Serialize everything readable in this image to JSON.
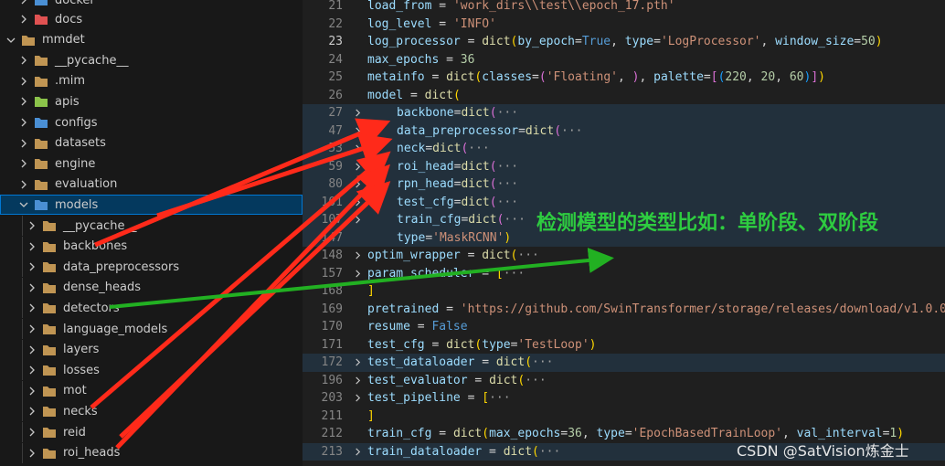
{
  "explorer": {
    "items": [
      {
        "label": "docker",
        "type": "folder-blue",
        "expanded": false,
        "depth": 1
      },
      {
        "label": "docs",
        "type": "folder-red",
        "expanded": false,
        "depth": 1
      },
      {
        "label": "mmdet",
        "type": "folder",
        "expanded": true,
        "depth": 0
      },
      {
        "label": "__pycache__",
        "type": "folder",
        "expanded": false,
        "depth": 1
      },
      {
        "label": ".mim",
        "type": "folder",
        "expanded": false,
        "depth": 1
      },
      {
        "label": "apis",
        "type": "folder-green",
        "expanded": false,
        "depth": 1
      },
      {
        "label": "configs",
        "type": "folder-blue",
        "expanded": false,
        "depth": 1
      },
      {
        "label": "datasets",
        "type": "folder",
        "expanded": false,
        "depth": 1
      },
      {
        "label": "engine",
        "type": "folder",
        "expanded": false,
        "depth": 1
      },
      {
        "label": "evaluation",
        "type": "folder",
        "expanded": false,
        "depth": 1
      },
      {
        "label": "models",
        "type": "folder-blue",
        "expanded": true,
        "depth": 1,
        "selected": true
      },
      {
        "label": "__pycache__",
        "type": "folder",
        "expanded": false,
        "depth": 2
      },
      {
        "label": "backbones",
        "type": "folder",
        "expanded": false,
        "depth": 2
      },
      {
        "label": "data_preprocessors",
        "type": "folder",
        "expanded": false,
        "depth": 2
      },
      {
        "label": "dense_heads",
        "type": "folder",
        "expanded": false,
        "depth": 2
      },
      {
        "label": "detectors",
        "type": "folder",
        "expanded": false,
        "depth": 2
      },
      {
        "label": "language_models",
        "type": "folder",
        "expanded": false,
        "depth": 2
      },
      {
        "label": "layers",
        "type": "folder",
        "expanded": false,
        "depth": 2
      },
      {
        "label": "losses",
        "type": "folder",
        "expanded": false,
        "depth": 2
      },
      {
        "label": "mot",
        "type": "folder",
        "expanded": false,
        "depth": 2
      },
      {
        "label": "necks",
        "type": "folder",
        "expanded": false,
        "depth": 2
      },
      {
        "label": "reid",
        "type": "folder",
        "expanded": false,
        "depth": 2
      },
      {
        "label": "roi_heads",
        "type": "folder",
        "expanded": false,
        "depth": 2
      }
    ]
  },
  "editor": {
    "lines": [
      {
        "num": "21",
        "indent": false,
        "fold": false,
        "hl": false,
        "tokens": [
          [
            "id",
            "load_from"
          ],
          [
            "op",
            " = "
          ],
          [
            "str",
            "'work_dirs\\\\test\\\\epoch_17.pth'"
          ]
        ]
      },
      {
        "num": "22",
        "indent": false,
        "fold": false,
        "hl": false,
        "tokens": [
          [
            "id",
            "log_level"
          ],
          [
            "op",
            " = "
          ],
          [
            "str",
            "'INFO'"
          ]
        ]
      },
      {
        "num": "23",
        "indent": false,
        "fold": false,
        "hl": false,
        "cur": true,
        "tokens": [
          [
            "id",
            "log_processor"
          ],
          [
            "op",
            " = "
          ],
          [
            "fn",
            "dict"
          ],
          [
            "br1",
            "("
          ],
          [
            "id",
            "by_epoch"
          ],
          [
            "op",
            "="
          ],
          [
            "kw",
            "True"
          ],
          [
            "op",
            ", "
          ],
          [
            "id",
            "type"
          ],
          [
            "op",
            "="
          ],
          [
            "str",
            "'LogProcessor'"
          ],
          [
            "op",
            ", "
          ],
          [
            "id",
            "window_size"
          ],
          [
            "op",
            "="
          ],
          [
            "num",
            "50"
          ],
          [
            "br1",
            ")"
          ]
        ]
      },
      {
        "num": "24",
        "indent": false,
        "fold": false,
        "hl": false,
        "tokens": [
          [
            "id",
            "max_epochs"
          ],
          [
            "op",
            " = "
          ],
          [
            "num",
            "36"
          ]
        ]
      },
      {
        "num": "25",
        "indent": false,
        "fold": false,
        "hl": false,
        "tokens": [
          [
            "id",
            "metainfo"
          ],
          [
            "op",
            " = "
          ],
          [
            "fn",
            "dict"
          ],
          [
            "br1",
            "("
          ],
          [
            "id",
            "classes"
          ],
          [
            "op",
            "="
          ],
          [
            "br2",
            "("
          ],
          [
            "str",
            "'Floating'"
          ],
          [
            "op",
            ", "
          ],
          [
            "br2",
            ")"
          ],
          [
            "op",
            ", "
          ],
          [
            "id",
            "palette"
          ],
          [
            "op",
            "="
          ],
          [
            "br2",
            "["
          ],
          [
            "br3",
            "("
          ],
          [
            "num",
            "220"
          ],
          [
            "op",
            ", "
          ],
          [
            "num",
            "20"
          ],
          [
            "op",
            ", "
          ],
          [
            "num",
            "60"
          ],
          [
            "br3",
            ")"
          ],
          [
            "br2",
            "]"
          ],
          [
            "br1",
            ")"
          ]
        ]
      },
      {
        "num": "26",
        "indent": false,
        "fold": false,
        "hl": false,
        "tokens": [
          [
            "id",
            "model"
          ],
          [
            "op",
            " = "
          ],
          [
            "fn",
            "dict"
          ],
          [
            "br1",
            "("
          ]
        ]
      },
      {
        "num": "27",
        "indent": true,
        "fold": true,
        "hl": true,
        "tokens": [
          [
            "id",
            "backbone"
          ],
          [
            "op",
            "="
          ],
          [
            "fn",
            "dict"
          ],
          [
            "br2",
            "("
          ],
          [
            "ell",
            "···"
          ]
        ]
      },
      {
        "num": "47",
        "indent": true,
        "fold": true,
        "hl": true,
        "tokens": [
          [
            "id",
            "data_preprocessor"
          ],
          [
            "op",
            "="
          ],
          [
            "fn",
            "dict"
          ],
          [
            "br2",
            "("
          ],
          [
            "ell",
            "···"
          ]
        ]
      },
      {
        "num": "53",
        "indent": true,
        "fold": true,
        "hl": true,
        "tokens": [
          [
            "id",
            "neck"
          ],
          [
            "op",
            "="
          ],
          [
            "fn",
            "dict"
          ],
          [
            "br2",
            "("
          ],
          [
            "ell",
            "···"
          ]
        ]
      },
      {
        "num": "59",
        "indent": true,
        "fold": true,
        "hl": true,
        "tokens": [
          [
            "id",
            "roi_head"
          ],
          [
            "op",
            "="
          ],
          [
            "fn",
            "dict"
          ],
          [
            "br2",
            "("
          ],
          [
            "ell",
            "···"
          ]
        ]
      },
      {
        "num": "80",
        "indent": true,
        "fold": true,
        "hl": true,
        "tokens": [
          [
            "id",
            "rpn_head"
          ],
          [
            "op",
            "="
          ],
          [
            "fn",
            "dict"
          ],
          [
            "br2",
            "("
          ],
          [
            "ell",
            "···"
          ]
        ]
      },
      {
        "num": "101",
        "indent": true,
        "fold": true,
        "hl": true,
        "tokens": [
          [
            "id",
            "test_cfg"
          ],
          [
            "op",
            "="
          ],
          [
            "fn",
            "dict"
          ],
          [
            "br2",
            "("
          ],
          [
            "ell",
            "···"
          ]
        ]
      },
      {
        "num": "107",
        "indent": true,
        "fold": true,
        "hl": true,
        "tokens": [
          [
            "id",
            "train_cfg"
          ],
          [
            "op",
            "="
          ],
          [
            "fn",
            "dict"
          ],
          [
            "br2",
            "("
          ],
          [
            "ell",
            "···"
          ]
        ]
      },
      {
        "num": "147",
        "indent": true,
        "fold": false,
        "hl": true,
        "tokens": [
          [
            "id",
            "type"
          ],
          [
            "op",
            "="
          ],
          [
            "str",
            "'MaskRCNN'"
          ],
          [
            "br1",
            ")"
          ]
        ]
      },
      {
        "num": "148",
        "indent": false,
        "fold": true,
        "hl": false,
        "tokens": [
          [
            "id",
            "optim_wrapper"
          ],
          [
            "op",
            " = "
          ],
          [
            "fn",
            "dict"
          ],
          [
            "br1",
            "("
          ],
          [
            "ell",
            "···"
          ]
        ]
      },
      {
        "num": "157",
        "indent": false,
        "fold": true,
        "hl": false,
        "tokens": [
          [
            "id",
            "param_scheduler"
          ],
          [
            "op",
            " = "
          ],
          [
            "br1",
            "["
          ],
          [
            "ell",
            "···"
          ]
        ]
      },
      {
        "num": "168",
        "indent": false,
        "fold": false,
        "hl": false,
        "tokens": [
          [
            "br1",
            "]"
          ]
        ]
      },
      {
        "num": "169",
        "indent": false,
        "fold": false,
        "hl": false,
        "tokens": [
          [
            "id",
            "pretrained"
          ],
          [
            "op",
            " = "
          ],
          [
            "str",
            "'https://github.com/SwinTransformer/storage/releases/download/v1.0.0/"
          ]
        ]
      },
      {
        "num": "170",
        "indent": false,
        "fold": false,
        "hl": false,
        "tokens": [
          [
            "id",
            "resume"
          ],
          [
            "op",
            " = "
          ],
          [
            "kw",
            "False"
          ]
        ]
      },
      {
        "num": "171",
        "indent": false,
        "fold": false,
        "hl": false,
        "tokens": [
          [
            "id",
            "test_cfg"
          ],
          [
            "op",
            " = "
          ],
          [
            "fn",
            "dict"
          ],
          [
            "br1",
            "("
          ],
          [
            "id",
            "type"
          ],
          [
            "op",
            "="
          ],
          [
            "str",
            "'TestLoop'"
          ],
          [
            "br1",
            ")"
          ]
        ]
      },
      {
        "num": "172",
        "indent": false,
        "fold": true,
        "hl": true,
        "tokens": [
          [
            "id",
            "test_dataloader"
          ],
          [
            "op",
            " = "
          ],
          [
            "fn",
            "dict"
          ],
          [
            "br1",
            "("
          ],
          [
            "ell",
            "···"
          ]
        ]
      },
      {
        "num": "196",
        "indent": false,
        "fold": true,
        "hl": false,
        "tokens": [
          [
            "id",
            "test_evaluator"
          ],
          [
            "op",
            " = "
          ],
          [
            "fn",
            "dict"
          ],
          [
            "br1",
            "("
          ],
          [
            "ell",
            "···"
          ]
        ]
      },
      {
        "num": "203",
        "indent": false,
        "fold": true,
        "hl": false,
        "tokens": [
          [
            "id",
            "test_pipeline"
          ],
          [
            "op",
            " = "
          ],
          [
            "br1",
            "["
          ],
          [
            "ell",
            "···"
          ]
        ]
      },
      {
        "num": "211",
        "indent": false,
        "fold": false,
        "hl": false,
        "tokens": [
          [
            "br1",
            "]"
          ]
        ]
      },
      {
        "num": "212",
        "indent": false,
        "fold": false,
        "hl": false,
        "tokens": [
          [
            "id",
            "train_cfg"
          ],
          [
            "op",
            " = "
          ],
          [
            "fn",
            "dict"
          ],
          [
            "br1",
            "("
          ],
          [
            "id",
            "max_epochs"
          ],
          [
            "op",
            "="
          ],
          [
            "num",
            "36"
          ],
          [
            "op",
            ", "
          ],
          [
            "id",
            "type"
          ],
          [
            "op",
            "="
          ],
          [
            "str",
            "'EpochBasedTrainLoop'"
          ],
          [
            "op",
            ", "
          ],
          [
            "id",
            "val_interval"
          ],
          [
            "op",
            "="
          ],
          [
            "num",
            "1"
          ],
          [
            "br1",
            ")"
          ]
        ]
      },
      {
        "num": "213",
        "indent": false,
        "fold": true,
        "hl": true,
        "tokens": [
          [
            "id",
            "train_dataloader"
          ],
          [
            "op",
            " = "
          ],
          [
            "fn",
            "dict"
          ],
          [
            "br1",
            "("
          ],
          [
            "ell",
            "···"
          ]
        ]
      }
    ]
  },
  "annotation": {
    "text": "检测模型的类型比如：单阶段、双阶段",
    "color": "#2ecc40"
  },
  "arrow_color": "#ff2a1a",
  "watermark": "CSDN @SatVision炼金士",
  "colors": {
    "selection": "#04395e",
    "selection_border": "#0078d4",
    "folder": "#c09553",
    "folder_blue": "#4a8fd4",
    "folder_green": "#8bc34a",
    "folder_red": "#e05252"
  }
}
